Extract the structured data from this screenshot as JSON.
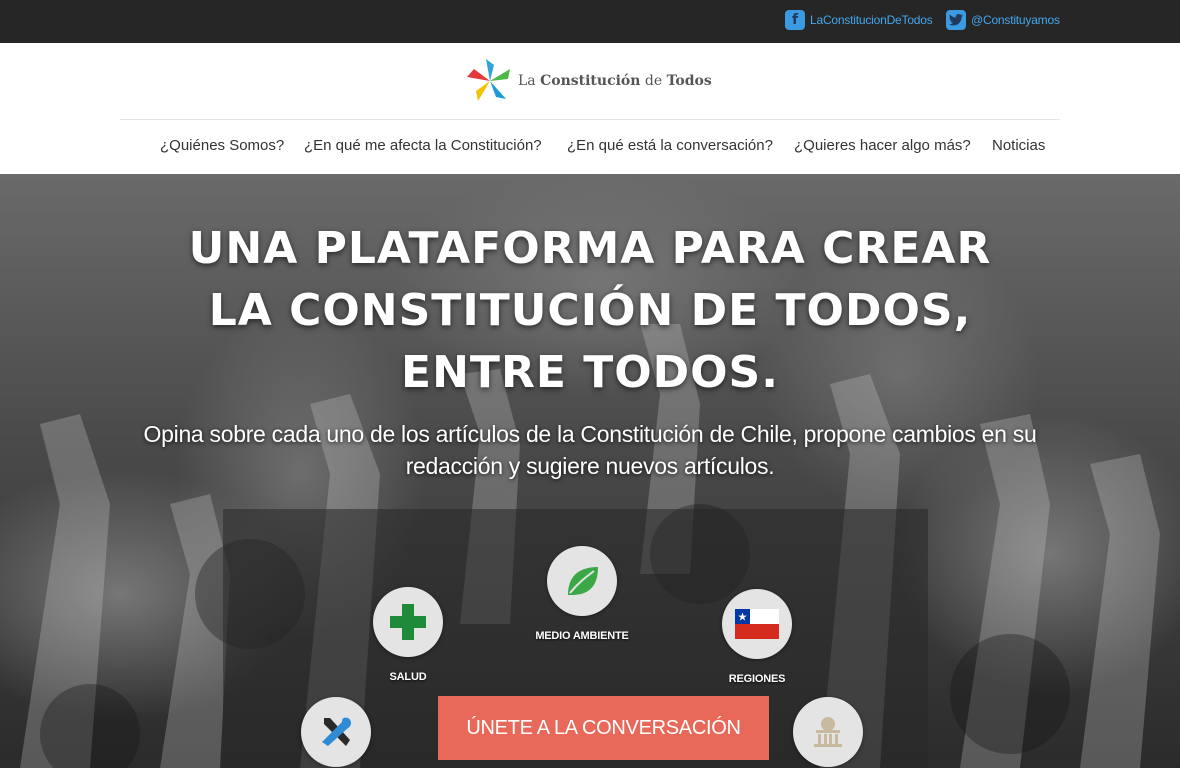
{
  "social": {
    "facebook_label": "LaConstitucionDeTodos",
    "twitter_label": "@Constituyamos"
  },
  "logo": {
    "prefix": "La",
    "main": "Constitución",
    "mid": "de",
    "suffix": "Todos"
  },
  "nav": {
    "items": [
      "¿Quiénes Somos?",
      "¿En qué me afecta la Constitución?",
      "¿En qué está la conversación?",
      "¿Quieres hacer algo más?",
      "Noticias"
    ]
  },
  "hero": {
    "title_lines": [
      "UNA PLATAFORMA PARA CREAR",
      "LA CONSTITUCIÓN DE TODOS,",
      "ENTRE TODOS."
    ],
    "subtitle": "Opina sobre cada uno de los artículos de la Constitución de Chile, propone cambios en su redacción y sugiere nuevos artículos."
  },
  "topics": [
    {
      "label": "SALUD",
      "icon": "medical-cross-icon"
    },
    {
      "label": "MEDIO AMBIENTE",
      "icon": "leaf-icon"
    },
    {
      "label": "REGIONES",
      "icon": "chile-flag-icon"
    },
    {
      "label": "",
      "icon": "tools-icon"
    },
    {
      "label": "",
      "icon": "capitol-building-icon"
    }
  ],
  "cta": {
    "label": "ÚNETE A LA CONVERSACIÓN"
  },
  "colors": {
    "topbar_bg": "#262626",
    "link_blue": "#43a6ee",
    "cta_bg": "#e8685a",
    "panel_bg": "rgba(40,40,40,0.55)"
  }
}
